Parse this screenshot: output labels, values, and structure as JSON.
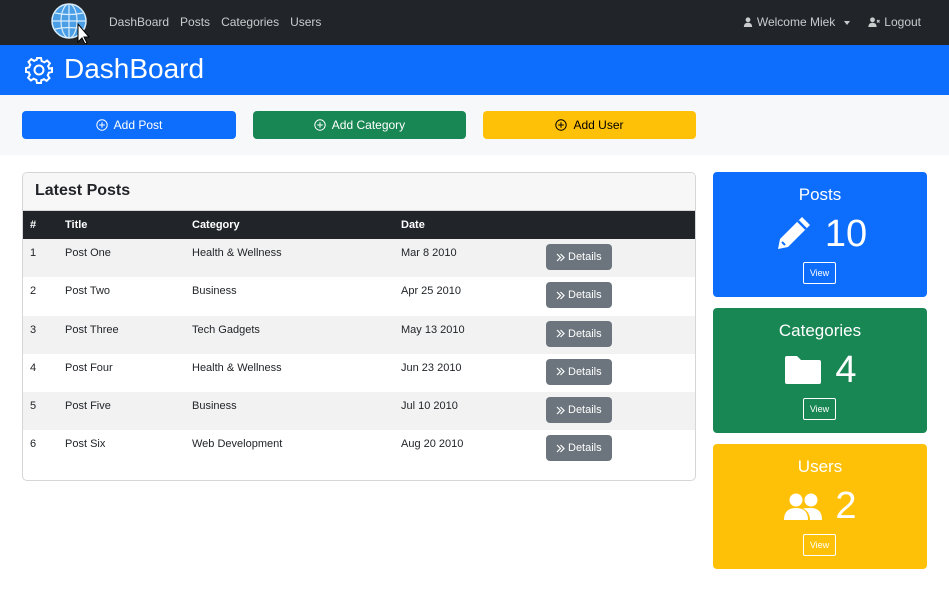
{
  "nav": {
    "links": [
      "DashBoard",
      "Posts",
      "Categories",
      "Users"
    ],
    "welcome": "Welcome Miek",
    "logout": "Logout"
  },
  "header": {
    "title": "DashBoard"
  },
  "actions": {
    "add_post": "Add Post",
    "add_category": "Add Category",
    "add_user": "Add User"
  },
  "latest_posts": {
    "title": "Latest Posts",
    "columns": [
      "#",
      "Title",
      "Category",
      "Date"
    ],
    "details_label": "Details",
    "rows": [
      {
        "num": "1",
        "title": "Post One",
        "category": "Health & Wellness",
        "date": "Mar 8 2010"
      },
      {
        "num": "2",
        "title": "Post Two",
        "category": "Business",
        "date": "Apr 25 2010"
      },
      {
        "num": "3",
        "title": "Post Three",
        "category": "Tech Gadgets",
        "date": "May 13 2010"
      },
      {
        "num": "4",
        "title": "Post Four",
        "category": "Health & Wellness",
        "date": "Jun 23 2010"
      },
      {
        "num": "5",
        "title": "Post Five",
        "category": "Business",
        "date": "Jul 10 2010"
      },
      {
        "num": "6",
        "title": "Post Six",
        "category": "Web Development",
        "date": "Aug 20 2010"
      }
    ]
  },
  "stats": {
    "posts": {
      "label": "Posts",
      "value": "10",
      "button": "View",
      "icon": "pencil-icon"
    },
    "categories": {
      "label": "Categories",
      "value": "4",
      "button": "View",
      "icon": "folder-icon"
    },
    "users": {
      "label": "Users",
      "value": "2",
      "button": "View",
      "icon": "users-icon"
    }
  },
  "colors": {
    "navbar": "#212529",
    "primary": "#0d6efd",
    "success": "#198754",
    "warning": "#ffc107",
    "secondary": "#6c757d"
  }
}
